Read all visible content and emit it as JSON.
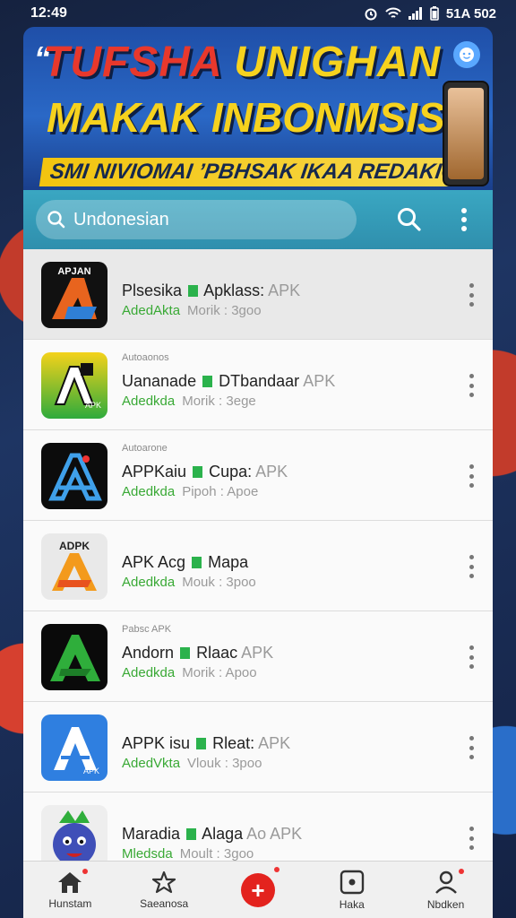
{
  "status_bar": {
    "time": "12:49",
    "right_text": "51A 502"
  },
  "banner": {
    "quote_mark": "“",
    "line1_red": "TUFSHA",
    "line1_yellow": "UNIGHAN",
    "line2": "MAKAK INBONMSISIA",
    "line3": "SMI NIVIOMAI ’PBHSAK IKAA REDAKION",
    "colors": {
      "red": "#e8382c",
      "yellow": "#f6d21e",
      "background": "#2a68c6"
    }
  },
  "search": {
    "placeholder": "Undonesian",
    "value": "Undonesian",
    "search_icon": "search-icon",
    "menu_icon": "more-vertical-icon"
  },
  "apps": [
    {
      "tag": "",
      "name": "Plsesika",
      "name_tail": "Apklass:",
      "suffix": "APK",
      "author": "AdedAkta",
      "meta": "Morik : 3goo",
      "icon_label": "APJAN",
      "icon_style": "orange-blue-a"
    },
    {
      "tag": "Autoaonos",
      "name": "Uananade",
      "name_tail": "DTbandaar",
      "suffix": "APK",
      "author": "Adedkda",
      "meta": "Morik : 3ege",
      "icon_label": "APK",
      "icon_style": "yellow-green-a"
    },
    {
      "tag": "Autoarone",
      "name": "APPKaiu",
      "name_tail": "Cupa:",
      "suffix": "APK",
      "author": "Adedkda",
      "meta": "Pipoh : Apoe",
      "icon_label": "",
      "icon_style": "blue-a"
    },
    {
      "tag": "",
      "name": "APK Acg",
      "name_tail": "Mapa",
      "suffix": "",
      "author": "Adedkda",
      "meta": "Mouk : 3poo",
      "icon_label": "ADPK",
      "icon_style": "orange-a"
    },
    {
      "tag": "Pabsc APK",
      "name": "Andorn",
      "name_tail": "Rlaac",
      "suffix": "APK",
      "author": "Adedkda",
      "meta": "Morik : Apoo",
      "icon_label": "",
      "icon_style": "green-a"
    },
    {
      "tag": "",
      "name": "APPK isu",
      "name_tail": "Rleat:",
      "suffix": "APK",
      "author": "AdedVkta",
      "meta": "Vlouk : 3poo",
      "icon_label": "APK",
      "icon_style": "blue-white-a"
    },
    {
      "tag": "",
      "name": "Maradia",
      "name_tail": "Alaga",
      "suffix": "Ao APK",
      "author": "Mledsda",
      "meta": "Moult : 3goo",
      "icon_label": "",
      "icon_style": "mascot"
    }
  ],
  "bottom_nav": [
    {
      "label": "Hunstam",
      "icon": "home-icon"
    },
    {
      "label": "Saeanosa",
      "icon": "explore-icon"
    },
    {
      "label": "",
      "icon": "add-icon"
    },
    {
      "label": "Haka",
      "icon": "play-box-icon"
    },
    {
      "label": "Nbdken",
      "icon": "profile-icon"
    }
  ],
  "colors": {
    "accent_teal": "#3aa7c2",
    "author_green": "#39a935",
    "fab_red": "#e3231e"
  }
}
